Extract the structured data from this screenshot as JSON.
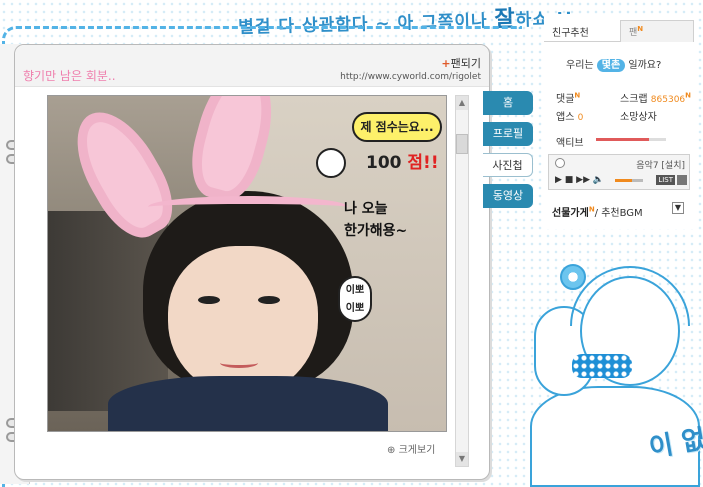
{
  "banner": {
    "pre": "별걸 다 상관함다 ~ 아 그쪽이나 ",
    "big": "잘",
    "post": "하쇼 !!"
  },
  "page": {
    "title": "향기만 남은 회분..",
    "follow_label": "팬되기",
    "url": "http://www.cyworld.com/rigolet",
    "enlarge_label": "크게보기"
  },
  "photo": {
    "score_bubble": "제 점수는요...",
    "score_num": "100",
    "score_suffix": "점!!",
    "today_text": "나 오늘\n한가해용~",
    "pretty_text": "이뽀\n이뽀"
  },
  "scroll": {
    "up_icon": "▲",
    "down_icon": "▼"
  },
  "tabs": [
    {
      "label": "홈"
    },
    {
      "label": "프로필"
    },
    {
      "label": "사진첩"
    },
    {
      "label": "동영상"
    }
  ],
  "sidebar": {
    "tab_recommend": "친구추천",
    "tab_fan": "팬",
    "new_mark": "N",
    "ask_pre": "우리는",
    "ask_hl": "몇촌",
    "ask_post": "일까요?",
    "comment_label": "댓글",
    "scrap_label": "스크랩",
    "scrap_count": "865306",
    "apps_label": "앱스",
    "apps_count": "0",
    "wish_label": "소망상자",
    "active_label": "액티브",
    "active_level": 0.75,
    "player_song": "음악7 [설치]",
    "player_play": "▶ ■ ▶▶ 🔈",
    "list_label": "LIST",
    "gift_label": "선물가게",
    "gift_sub": "/ 추천BGM",
    "gift_btn": "▼"
  },
  "cartoon": {
    "caption": "이 없음다 !!"
  }
}
